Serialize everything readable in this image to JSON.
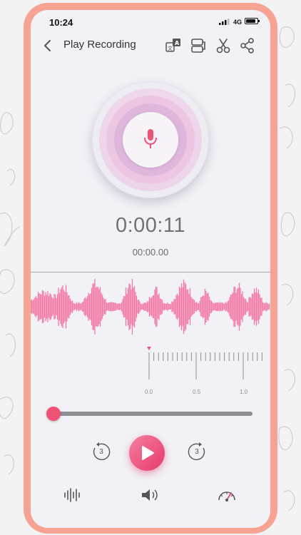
{
  "status_bar": {
    "time": "10:24",
    "network": "4G"
  },
  "header": {
    "title": "Play Recording"
  },
  "toolbar_icons": [
    "translate-icon",
    "document-icon",
    "scissors-icon",
    "share-icon"
  ],
  "timer": {
    "elapsed": "0:00:11",
    "position": "00:00.00"
  },
  "ruler": {
    "labels": [
      "0.0",
      "0.5",
      "1.0"
    ]
  },
  "playback": {
    "skip_back_seconds": "3",
    "skip_forward_seconds": "3",
    "progress": 0.0
  },
  "bottom_tools": [
    "waveform-icon",
    "volume-icon",
    "speed-gauge-icon"
  ],
  "colors": {
    "accent": "#ee5276",
    "waveform": "#f27aa6",
    "phone_frame": "#f6a394",
    "screen": "#f1f1f6"
  }
}
